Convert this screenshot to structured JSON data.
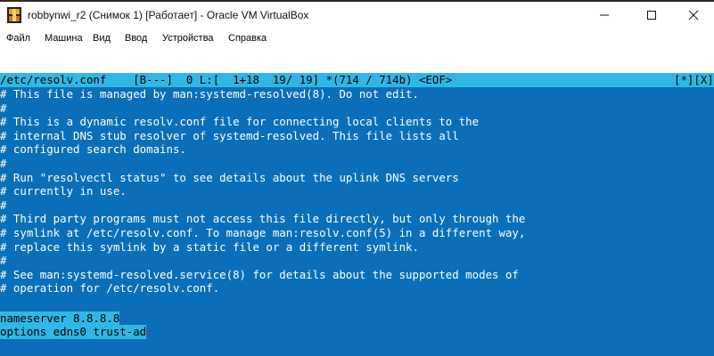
{
  "window": {
    "title": "robbynwi_r2 (Снимок 1) [Работает] - Oracle VM VirtualBox"
  },
  "menu": {
    "items": [
      "Файл",
      "Машина",
      "Вид",
      "Ввод",
      "Устройства",
      "Справка"
    ]
  },
  "editor": {
    "status_left": "/etc/resolv.conf    [B---]  0 L:[  1+18  19/ 19] *(714 / 714b) <EOF>",
    "status_right": "[*][X]",
    "lines": [
      "# This file is managed by man:systemd-resolved(8). Do not edit.",
      "#",
      "# This is a dynamic resolv.conf file for connecting local clients to the",
      "# internal DNS stub resolver of systemd-resolved. This file lists all",
      "# configured search domains.",
      "#",
      "# Run \"resolvectl status\" to see details about the uplink DNS servers",
      "# currently in use.",
      "#",
      "# Third party programs must not access this file directly, but only through the",
      "# symlink at /etc/resolv.conf. To manage man:resolv.conf(5) in a different way,",
      "# replace this symlink by a static file or a different symlink.",
      "#",
      "# See man:systemd-resolved.service(8) for details about the supported modes of",
      "# operation for /etc/resolv.conf.",
      "",
      "nameserver 8.8.8.8",
      "options edns0 trust-ad"
    ]
  },
  "colors": {
    "screen_bg": "#0a6fb8",
    "highlight": "#2fb7e5"
  }
}
